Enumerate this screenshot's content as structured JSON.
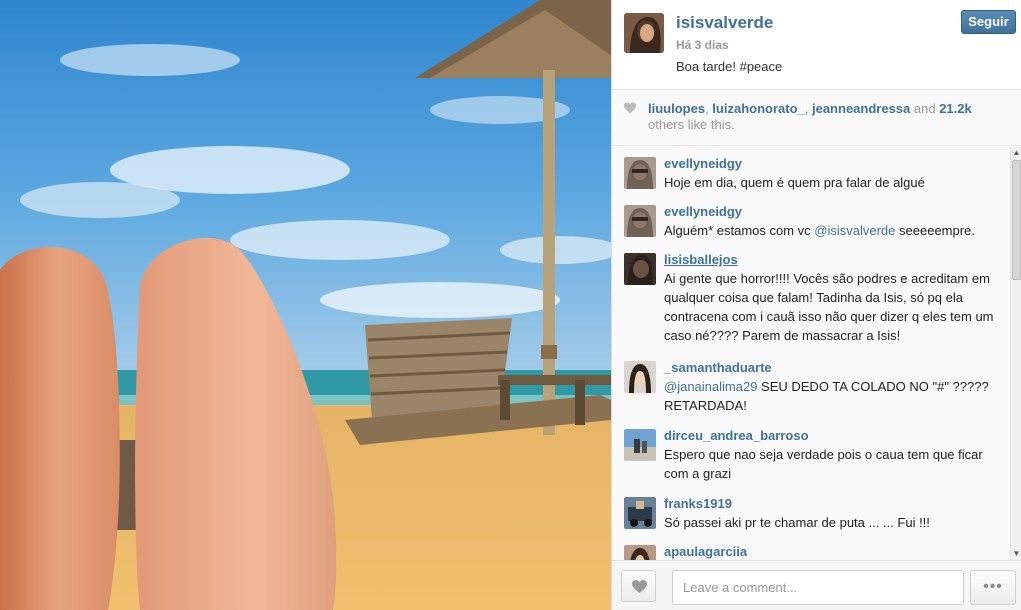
{
  "post": {
    "username": "isisvalverde",
    "time": "Há 3 dias",
    "caption": "Boa tarde! #peace",
    "follow_label": "Seguir"
  },
  "likes": {
    "users": [
      "liuulopes",
      "luizahonorato_",
      "jeanneandressa"
    ],
    "separator_1": ", ",
    "separator_2": ", ",
    "and_text": " and ",
    "count": "21.2k",
    "others_text": " others like this."
  },
  "comments": [
    {
      "user": "evellyneidgy",
      "text": "Hoje em dia, quem é quem pra falar de algué"
    },
    {
      "user": "evellyneidgy",
      "text_before": "Alguém* estamos com vc ",
      "mention": "@isisvalverde",
      "text_after": " seeeeempre."
    },
    {
      "user": "lisisballejos",
      "text": "Ai gente que horror!!!! Vocês são podres e acreditam em qualquer coisa que falam! Tadinha da Isis, só pq ela contracena com i cauã isso não quer dizer q eles tem um caso né???? Parem de massacrar a Isis!"
    },
    {
      "user": "_samanthaduarte",
      "text_before": "",
      "mention": "@janainalima29",
      "text_after": " SEU DEDO TA COLADO NO \"#\" ????? RETARDADA!"
    },
    {
      "user": "dirceu_andrea_barroso",
      "text": "Espero que nao seja verdade pois o caua tem que ficar com a grazi"
    },
    {
      "user": "franks1919",
      "text": "Só passei aki pr te chamar de puta ... ... Fui !!!"
    },
    {
      "user": "apaulagarciia",
      "text": ""
    }
  ],
  "footer": {
    "comment_placeholder": "Leave a comment...",
    "more_label": "•••"
  },
  "colors": {
    "link": "#3f729b",
    "follow_button": "#3f729b"
  }
}
